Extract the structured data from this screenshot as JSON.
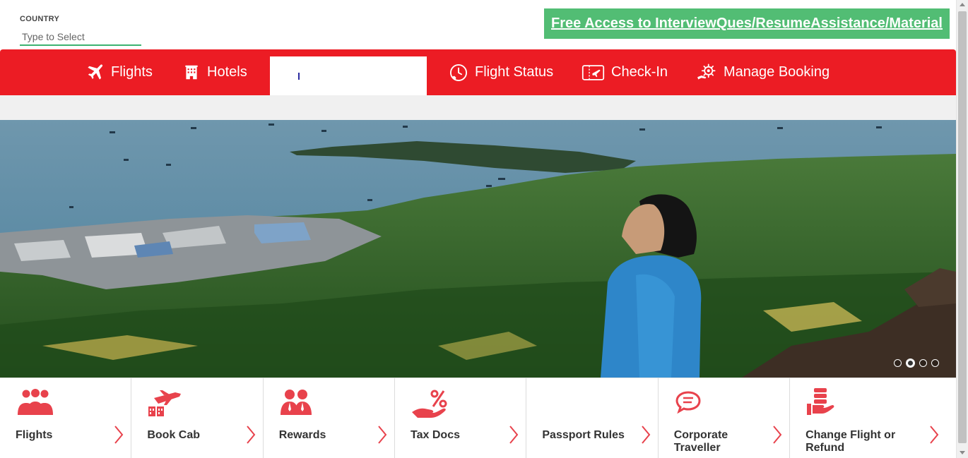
{
  "country": {
    "label": "COUNTRY",
    "placeholder": "Type to Select"
  },
  "promo": {
    "text": "Free Access to InterviewQues/ResumeAssistance/Material",
    "color": "#52bd74"
  },
  "nav": {
    "color": "#ec1c24",
    "items": [
      {
        "label": "Flights",
        "icon": "airplane-icon"
      },
      {
        "label": "Hotels",
        "icon": "hotel-icon"
      },
      {
        "label": "",
        "icon": ""
      },
      {
        "label": "Flight Status",
        "icon": "clock-plane-icon"
      },
      {
        "label": "Check-In",
        "icon": "ticket-icon"
      },
      {
        "label": "Manage Booking",
        "icon": "gear-hand-icon"
      }
    ]
  },
  "hero": {
    "slide_count": 4,
    "active_slide": 2
  },
  "services": [
    {
      "label": "Flights",
      "icon": "group-icon"
    },
    {
      "label": "Book Cab",
      "icon": "cab-plane-icon"
    },
    {
      "label": "Rewards",
      "icon": "people-icon"
    },
    {
      "label": "Tax Docs",
      "icon": "percent-hand-icon"
    },
    {
      "label": "Passport Rules",
      "icon": ""
    },
    {
      "label": "Corporate Traveller",
      "icon": "chat-bubble-icon"
    },
    {
      "label": "Change Flight or Refund",
      "icon": "money-hand-icon"
    }
  ],
  "colors": {
    "accent_red": "#ec1c24",
    "icon_red": "#e8424c",
    "green": "#52bd74"
  }
}
